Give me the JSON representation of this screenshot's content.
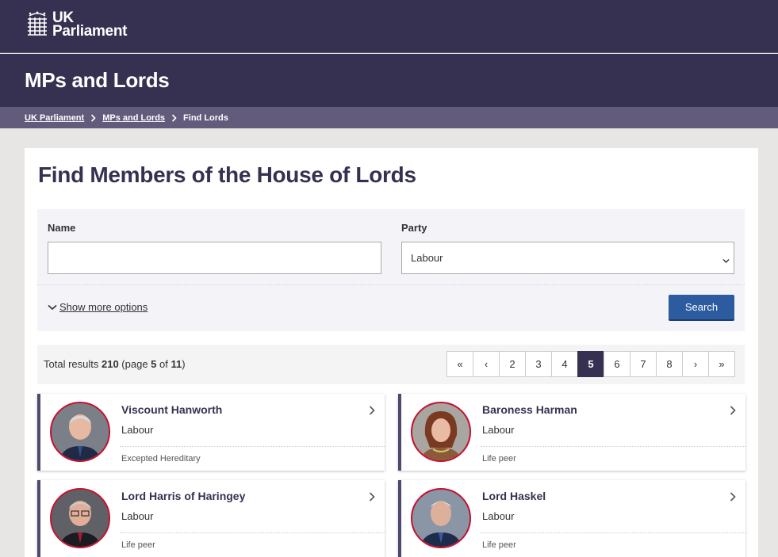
{
  "header": {
    "logo_line1": "UK",
    "logo_line2": "Parliament",
    "section_title": "MPs and Lords"
  },
  "breadcrumb": {
    "items": [
      "UK Parliament",
      "MPs and Lords"
    ],
    "current": "Find Lords"
  },
  "page": {
    "title": "Find Members of the House of Lords"
  },
  "filters": {
    "name_label": "Name",
    "name_value": "",
    "party_label": "Party",
    "party_value": "Labour",
    "more_options": "Show more options",
    "search_label": "Search"
  },
  "results": {
    "prefix": "Total results ",
    "total": "210",
    "page_prefix": " (page ",
    "page": "5",
    "of": " of ",
    "pages": "11",
    "suffix": ")"
  },
  "pagination": [
    "«",
    "‹",
    "2",
    "3",
    "4",
    "5",
    "6",
    "7",
    "8",
    "›",
    "»"
  ],
  "pagination_active": "5",
  "members": [
    {
      "name": "Viscount Hanworth",
      "party": "Labour",
      "type": "Excepted Hereditary"
    },
    {
      "name": "Baroness Harman",
      "party": "Labour",
      "type": "Life peer"
    },
    {
      "name": "Lord Harris of Haringey",
      "party": "Labour",
      "type": "Life peer"
    },
    {
      "name": "Lord Haskel",
      "party": "Labour",
      "type": "Life peer"
    }
  ],
  "colors": {
    "brand": "#373151",
    "breadcrumb_bg": "#625b7b",
    "search_button": "#2c5ba0",
    "avatar_ring": "#c8102e"
  }
}
